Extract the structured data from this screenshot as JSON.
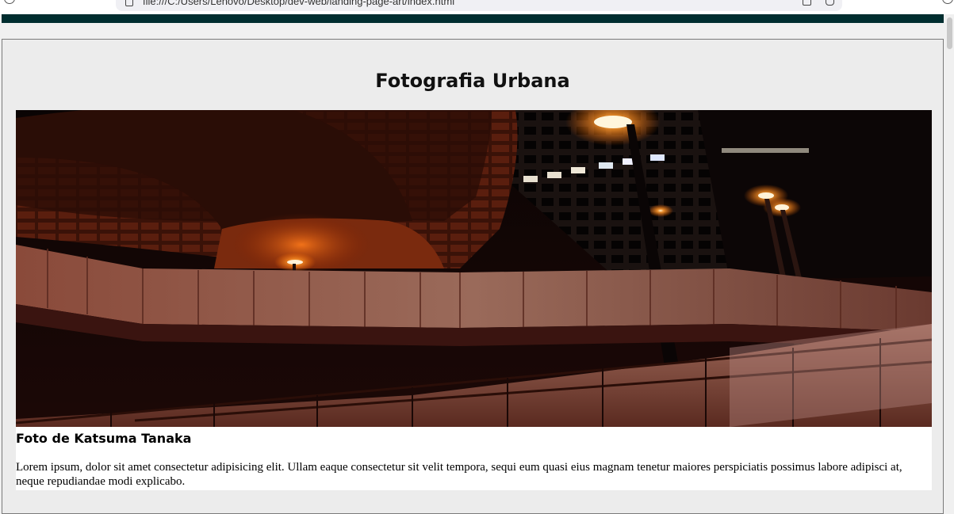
{
  "browser": {
    "url": "file:///C:/Users/Lenovo/Desktop/dev-web/landing-page-art/index.html"
  },
  "card": {
    "title": "Fotografia Urbana",
    "photo_caption": "Foto de Katsuma Tanaka",
    "description": "Lorem ipsum, dolor sit amet consectetur adipisicing elit. Ullam eaque consectetur sit velit tempora, sequi eum quasi eius magnam tenetur maiores perspiciatis possimus labore adipisci at, neque repudiandae modi explicabo."
  },
  "colors": {
    "header_bar": "#002d2f",
    "page_background": "#ececec"
  }
}
